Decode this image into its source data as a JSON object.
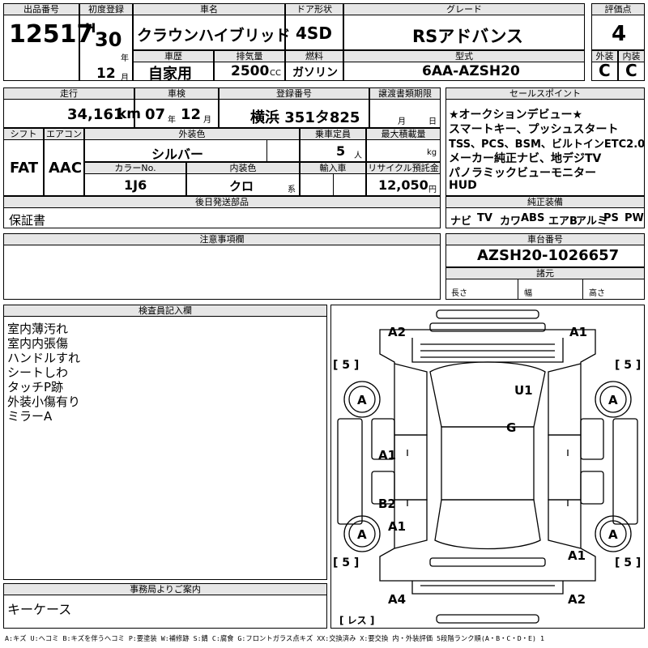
{
  "labels": {
    "lot_no": "出品番号",
    "first_reg": "初度登録",
    "car_name": "車名",
    "door": "ドア形状",
    "grade": "グレード",
    "score": "評価点",
    "history": "車歴",
    "displacement": "排気量",
    "fuel": "燃料",
    "model_code": "型式",
    "exterior": "外装",
    "interior": "内装",
    "mileage": "走行",
    "inspection": "車検",
    "registration": "登録番号",
    "transfer_deadline": "譲渡書類期限",
    "sales_points": "セールスポイント",
    "shift": "シフト",
    "aircon": "エアコン",
    "ext_color": "外装色",
    "capacity": "乗車定員",
    "max_load": "最大積載量",
    "color_no": "カラーNo.",
    "int_color": "内装色",
    "import": "輸入車",
    "recycle": "リサイクル預託金",
    "later_parts": "後日発送部品",
    "genuine_equipment": "純正装備",
    "notes": "注意事項欄",
    "chassis_no": "車台番号",
    "dimensions": "諸元",
    "length": "長さ",
    "width": "幅",
    "height": "高さ",
    "inspector_notes": "検査員記入欄",
    "office_notes": "事務局よりご案内"
  },
  "vehicle": {
    "lot_no": "12517",
    "era": "H",
    "year": "30",
    "year_unit": "年",
    "month": "12",
    "month_unit": "月",
    "name": "クラウンハイブリッド",
    "door": "4SD",
    "grade": "RSアドバンス",
    "score": "4",
    "history": "自家用",
    "displacement": "2500",
    "cc": "CC",
    "fuel": "ガソリン",
    "model_code": "6AA-AZSH20",
    "exterior_grade": "C",
    "interior_grade": "C",
    "mileage": "34,161",
    "km": "km",
    "inspection_year": "07",
    "inspection_month": "12",
    "year_unit2": "年",
    "month_unit2": "月",
    "registration": "横浜 351タ825",
    "deadline_month": "月",
    "deadline_day": "日",
    "shift": "FAT",
    "aircon": "AAC",
    "ext_color": "シルバー",
    "capacity": "5",
    "capacity_unit": "人",
    "max_load_unit": "kg",
    "color_no": "1J6",
    "int_color": "クロ",
    "int_color_unit": "系",
    "recycle": "12,050",
    "recycle_unit": "円",
    "later_parts": "保証書",
    "chassis_no": "AZSH20-1026657"
  },
  "sales_points": [
    "★オークションデビュー★",
    "スマートキー、プッシュスタート",
    "TSS、PCS、BSM、ビルトインETC2.0",
    "メーカー純正ナビ、地デジTV",
    "パノラミックビューモニター",
    "HUD"
  ],
  "equipment": [
    "ナビ",
    "TV",
    "カワ",
    "ABS",
    "エアB",
    "アルミ",
    "PS",
    "PW"
  ],
  "inspector_notes": [
    "室内薄汚れ",
    "室内内張傷",
    "ハンドルすれ",
    "シートしわ",
    "タッチP跡",
    "外装小傷有り",
    "ミラーA"
  ],
  "office_notes": "キーケース",
  "diagram": {
    "marks": [
      "A2",
      "A1",
      "U1",
      "G",
      "A1",
      "B2",
      "A1",
      "A1",
      "A4",
      "A2",
      "A",
      "A",
      "A",
      "A"
    ],
    "tires": [
      "5",
      "5",
      "5",
      "5"
    ],
    "spare": "レス"
  },
  "legend": "A:キズ U:ヘコミ B:キズを伴うヘコミ P:要塗装 W:補修跡 S:錆 C:腐食 G:フロントガラス点キズ XX:交換済み X:要交換 内・外装評価 5段階ランク順(A・B・C・D・E) 1"
}
